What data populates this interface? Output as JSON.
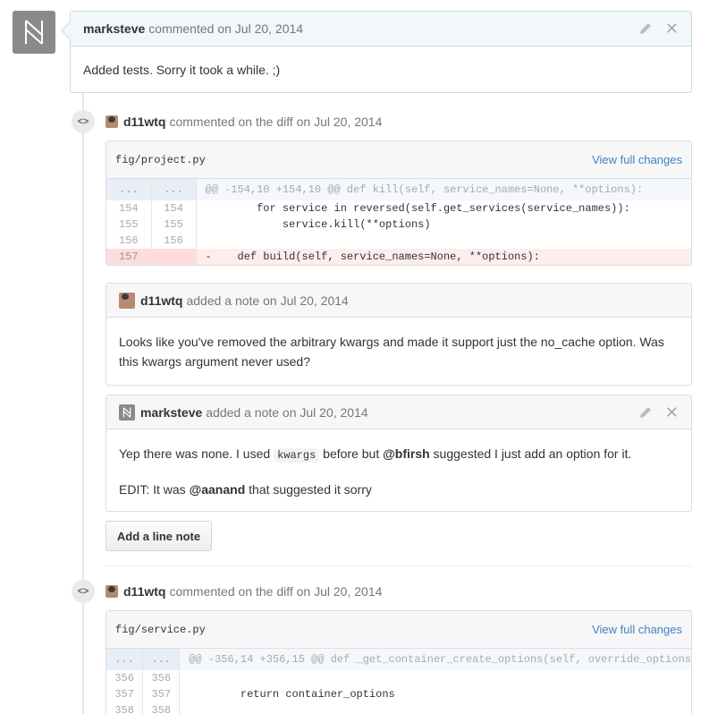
{
  "comment1": {
    "author": "marksteve",
    "meta": "commented on Jul 20, 2014",
    "body": "Added tests. Sorry it took a while. ;)"
  },
  "discussion1": {
    "author": "d11wtq",
    "meta": "commented on the diff on Jul 20, 2014",
    "file": "fig/project.py",
    "view_label": "View full changes",
    "hunk": "@@ -154,10 +154,10 @@ def kill(self, service_names=None, **options):",
    "ellipsis": "...",
    "lines": [
      {
        "old": "154",
        "new": "154",
        "code": "        for service in reversed(self.get_services(service_names)):",
        "type": "ctx"
      },
      {
        "old": "155",
        "new": "155",
        "code": "            service.kill(**options)",
        "type": "ctx"
      },
      {
        "old": "156",
        "new": "156",
        "code": "",
        "type": "ctx"
      },
      {
        "old": "157",
        "new": "",
        "code": "-    def build(self, service_names=None, **options):",
        "type": "del"
      }
    ],
    "note1": {
      "author": "d11wtq",
      "meta": "added a note on Jul 20, 2014",
      "body": "Looks like you've removed the arbitrary kwargs and made it support just the no_cache option. Was this kwargs argument never used?"
    },
    "note2": {
      "author": "marksteve",
      "meta": "added a note on Jul 20, 2014",
      "p1_a": "Yep there was none. I used ",
      "p1_code": "kwargs",
      "p1_b": " before but ",
      "p1_mention": "@bfirsh",
      "p1_c": " suggested I just add an option for it.",
      "p2_a": "EDIT: It was ",
      "p2_mention": "@aanand",
      "p2_b": " that suggested it sorry"
    },
    "button": "Add a line note"
  },
  "discussion2": {
    "author": "d11wtq",
    "meta": "commented on the diff on Jul 20, 2014",
    "file": "fig/service.py",
    "view_label": "View full changes",
    "hunk": "@@ -356,14 +356,15 @@ def _get_container_create_options(self, override_options",
    "ellipsis": "...",
    "lines": [
      {
        "old": "356",
        "new": "356",
        "code": ""
      },
      {
        "old": "357",
        "new": "357",
        "code": "        return container_options"
      },
      {
        "old": "358",
        "new": "358",
        "code": ""
      }
    ]
  },
  "icons": {
    "diff": "code-brackets-icon",
    "edit": "pencil-icon",
    "close": "close-icon"
  }
}
